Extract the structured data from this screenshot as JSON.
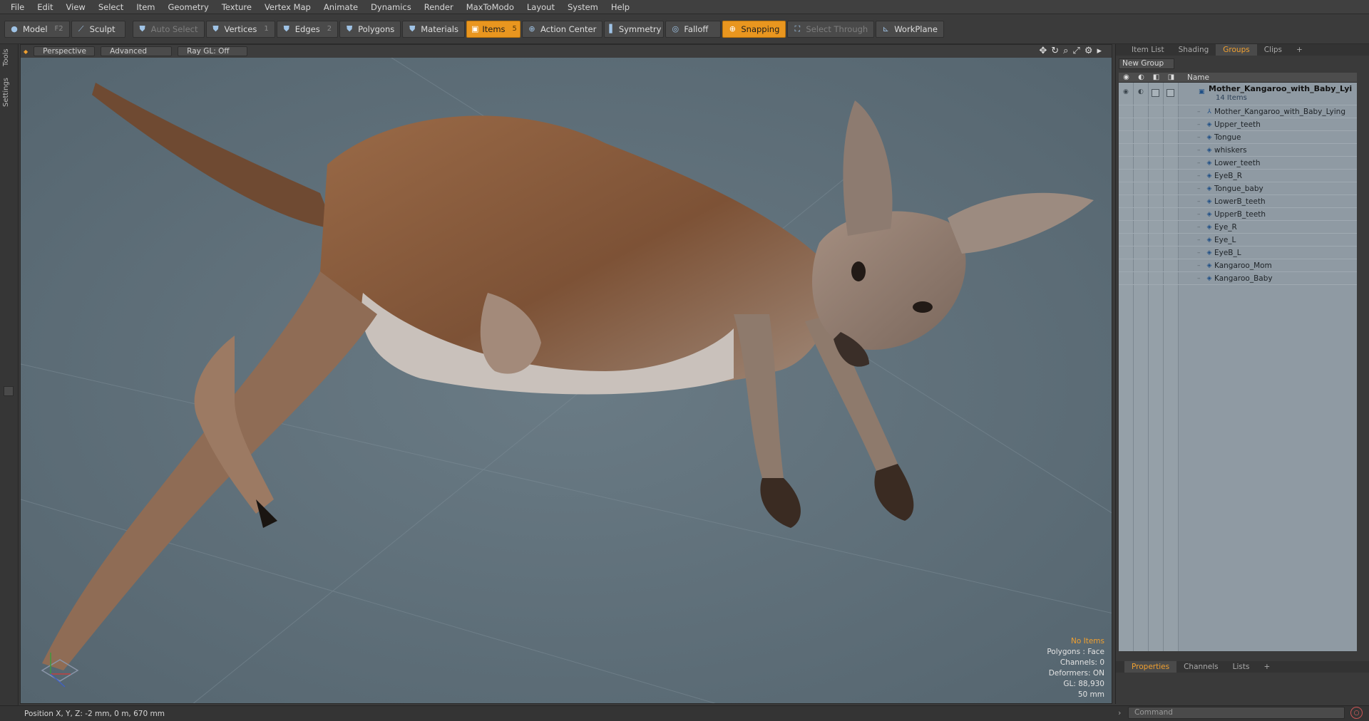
{
  "menu": [
    "File",
    "Edit",
    "View",
    "Select",
    "Item",
    "Geometry",
    "Texture",
    "Vertex Map",
    "Animate",
    "Dynamics",
    "Render",
    "MaxToModo",
    "Layout",
    "System",
    "Help"
  ],
  "toolbar": {
    "model": "Model",
    "model_key": "F2",
    "sculpt": "Sculpt",
    "auto_select": "Auto Select",
    "vertices": "Vertices",
    "vertices_key": "1",
    "edges": "Edges",
    "edges_key": "2",
    "polygons": "Polygons",
    "materials": "Materials",
    "items": "Items",
    "items_key": "5",
    "action_center": "Action Center",
    "symmetry": "Symmetry",
    "falloff": "Falloff",
    "snapping": "Snapping",
    "select_through": "Select Through",
    "workplane": "WorkPlane",
    "accent": "#e9961f"
  },
  "lefttabs": {
    "tools": "Tools",
    "settings": "Settings"
  },
  "viewport": {
    "projection": "Perspective",
    "shading": "Advanced",
    "raygl": "Ray GL: Off",
    "hud": {
      "no_items": "No Items",
      "polygons": "Polygons : Face",
      "channels": "Channels: 0",
      "deformers": "Deformers: ON",
      "gl": "GL: 88,930",
      "focal": "50 mm"
    }
  },
  "rightpanel": {
    "tabs": [
      "Item List",
      "Shading",
      "Groups",
      "Clips",
      "+"
    ],
    "active_tab": "Groups",
    "new_group": "New Group",
    "name_header": "Name",
    "group_title": "Mother_Kangaroo_with_Baby_Lyi ...",
    "group_sub": "14 Items",
    "items": [
      "Mother_Kangaroo_with_Baby_Lying",
      "Upper_teeth",
      "Tongue",
      "whiskers",
      "Lower_teeth",
      "EyeB_R",
      "Tongue_baby",
      "LowerB_teeth",
      "UpperB_teeth",
      "Eye_R",
      "Eye_L",
      "EyeB_L",
      "Kangaroo_Mom",
      "Kangaroo_Baby"
    ]
  },
  "bottompanel": {
    "tabs": [
      "Properties",
      "Channels",
      "Lists",
      "+"
    ],
    "active_tab": "Properties"
  },
  "status": {
    "position": "Position X, Y, Z:   -2 mm, 0 m, 670 mm",
    "command_placeholder": "Command"
  }
}
